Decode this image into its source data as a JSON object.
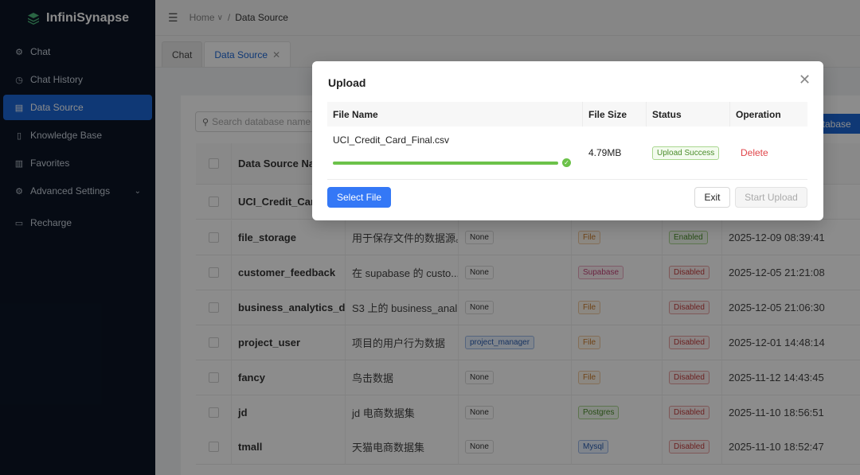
{
  "app": {
    "logo_part1": "Infini",
    "logo_part2": "Synapse"
  },
  "sidebar": {
    "items": [
      {
        "label": "Chat",
        "icon": "chat-icon"
      },
      {
        "label": "Chat History",
        "icon": "history-icon"
      },
      {
        "label": "Data Source",
        "icon": "data-source-icon",
        "active": true
      },
      {
        "label": "Knowledge Base",
        "icon": "knowledge-icon"
      },
      {
        "label": "Favorites",
        "icon": "favorites-icon"
      },
      {
        "label": "Advanced Settings",
        "icon": "settings-icon"
      },
      {
        "label": "Recharge",
        "icon": "recharge-icon"
      }
    ]
  },
  "header": {
    "crumb_home": "Home",
    "crumb_current": "Data Source"
  },
  "tabs": [
    {
      "label": "Chat"
    },
    {
      "label": "Data Source"
    }
  ],
  "content": {
    "search_placeholder": "Search database name",
    "add_button_label": "atabase",
    "table": {
      "header_name": "Data Source Nam",
      "rows": [
        {
          "name": "UCI_Credit_Card",
          "desc": "",
          "role": "",
          "type": "",
          "type_color": "",
          "status": "",
          "status_color": "",
          "time": ""
        },
        {
          "name": "file_storage",
          "desc": "用于保存文件的数据源。",
          "role": "None",
          "type": "File",
          "type_color": "orange",
          "status": "Enabled",
          "status_color": "green",
          "time": "2025-12-09 08:39:41"
        },
        {
          "name": "customer_feedback",
          "desc": "在 supabase 的 custo...",
          "role": "None",
          "type": "Supabase",
          "type_color": "pink",
          "status": "Disabled",
          "status_color": "red",
          "time": "2025-12-05 21:21:08"
        },
        {
          "name": "business_analytics_d...",
          "desc": "S3 上的 business_anal...",
          "role": "None",
          "type": "File",
          "type_color": "orange",
          "status": "Disabled",
          "status_color": "red",
          "time": "2025-12-05 21:06:30"
        },
        {
          "name": "project_user",
          "desc": "项目的用户行为数据",
          "role": "project_manager",
          "type": "File",
          "type_color": "orange",
          "status": "Disabled",
          "status_color": "red",
          "time": "2025-12-01 14:48:14"
        },
        {
          "name": "fancy",
          "desc": "鸟击数据",
          "role": "None",
          "type": "File",
          "type_color": "orange",
          "status": "Disabled",
          "status_color": "red",
          "time": "2025-11-12 14:43:45"
        },
        {
          "name": "jd",
          "desc": "jd 电商数据集",
          "role": "None",
          "type": "Postgres",
          "type_color": "green",
          "status": "Disabled",
          "status_color": "red",
          "time": "2025-11-10 18:56:51"
        },
        {
          "name": "tmall",
          "desc": "天猫电商数据集",
          "role": "None",
          "type": "Mysql",
          "type_color": "blue",
          "status": "Disabled",
          "status_color": "red",
          "time": "2025-11-10 18:52:47"
        }
      ]
    }
  },
  "modal": {
    "title": "Upload",
    "columns": {
      "file_name": "File Name",
      "file_size": "File Size",
      "status": "Status",
      "operation": "Operation"
    },
    "file": {
      "name": "UCI_Credit_Card_Final.csv",
      "size": "4.79MB",
      "status": "Upload Success",
      "operation": "Delete",
      "progress": 1.0
    },
    "select_button": "Select File",
    "exit_button": "Exit",
    "start_button": "Start Upload"
  },
  "colors": {
    "accent": "#1d67d6",
    "sidebar_bg": "#0b1526",
    "success": "#6cc24a",
    "danger": "#e0454a"
  }
}
